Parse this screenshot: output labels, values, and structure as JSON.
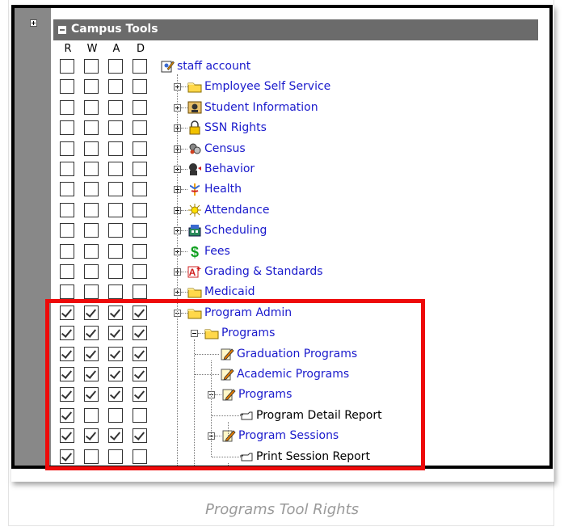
{
  "panel": {
    "title": "Campus Tools",
    "columns": [
      "R",
      "W",
      "A",
      "D"
    ]
  },
  "tree": [
    {
      "label": "staff account",
      "icon": "staff-account-icon",
      "checks": [
        false,
        false,
        false,
        false
      ],
      "indent": 0,
      "toggle": "none",
      "link": true
    },
    {
      "label": "Employee Self Service",
      "icon": "folder-icon",
      "checks": [
        false,
        false,
        false,
        false
      ],
      "indent": 1,
      "toggle": "plus",
      "link": true
    },
    {
      "label": "Student Information",
      "icon": "student-icon",
      "checks": [
        false,
        false,
        false,
        false
      ],
      "indent": 1,
      "toggle": "plus",
      "link": true
    },
    {
      "label": "SSN Rights",
      "icon": "lock-icon",
      "checks": [
        false,
        false,
        false,
        false
      ],
      "indent": 1,
      "toggle": "plus",
      "link": true
    },
    {
      "label": "Census",
      "icon": "census-icon",
      "checks": [
        false,
        false,
        false,
        false
      ],
      "indent": 1,
      "toggle": "plus",
      "link": true
    },
    {
      "label": "Behavior",
      "icon": "behavior-icon",
      "checks": [
        false,
        false,
        false,
        false
      ],
      "indent": 1,
      "toggle": "plus",
      "link": true
    },
    {
      "label": "Health",
      "icon": "health-icon",
      "checks": [
        false,
        false,
        false,
        false
      ],
      "indent": 1,
      "toggle": "plus",
      "link": true
    },
    {
      "label": "Attendance",
      "icon": "attendance-icon",
      "checks": [
        false,
        false,
        false,
        false
      ],
      "indent": 1,
      "toggle": "plus",
      "link": true
    },
    {
      "label": "Scheduling",
      "icon": "scheduling-icon",
      "checks": [
        false,
        false,
        false,
        false
      ],
      "indent": 1,
      "toggle": "plus",
      "link": true
    },
    {
      "label": "Fees",
      "icon": "dollar-icon",
      "checks": [
        false,
        false,
        false,
        false
      ],
      "indent": 1,
      "toggle": "plus",
      "link": true
    },
    {
      "label": "Grading & Standards",
      "icon": "grading-icon",
      "checks": [
        false,
        false,
        false,
        false
      ],
      "indent": 1,
      "toggle": "plus",
      "link": true
    },
    {
      "label": "Medicaid",
      "icon": "folder-icon",
      "checks": [
        false,
        false,
        false,
        false
      ],
      "indent": 1,
      "toggle": "plus",
      "link": true
    },
    {
      "label": "Program Admin",
      "icon": "folder-icon",
      "checks": [
        true,
        true,
        true,
        true
      ],
      "indent": 1,
      "toggle": "minus",
      "link": true
    },
    {
      "label": "Programs",
      "icon": "folder-icon",
      "checks": [
        true,
        true,
        true,
        true
      ],
      "indent": 2,
      "toggle": "minus",
      "link": true
    },
    {
      "label": "Graduation Programs",
      "icon": "edit-icon",
      "checks": [
        true,
        true,
        true,
        true
      ],
      "indent": 3,
      "toggle": "none",
      "link": true
    },
    {
      "label": "Academic Programs",
      "icon": "edit-icon",
      "checks": [
        true,
        true,
        true,
        true
      ],
      "indent": 3,
      "toggle": "none",
      "link": true
    },
    {
      "label": "Programs",
      "icon": "edit-icon",
      "checks": [
        true,
        true,
        true,
        true
      ],
      "indent": 3,
      "toggle": "minus",
      "link": true
    },
    {
      "label": "Program Detail Report",
      "icon": "report-icon",
      "checks": [
        true,
        false,
        false,
        false
      ],
      "indent": 4,
      "toggle": "none",
      "link": false
    },
    {
      "label": "Program Sessions",
      "icon": "edit-icon",
      "checks": [
        true,
        true,
        true,
        true
      ],
      "indent": 3,
      "toggle": "minus",
      "link": true
    },
    {
      "label": "Print Session Report",
      "icon": "report-icon",
      "checks": [
        true,
        false,
        false,
        false
      ],
      "indent": 4,
      "toggle": "none",
      "link": false
    }
  ],
  "caption": "Programs Tool Rights",
  "colors": {
    "header_bg": "#6b6b6b",
    "gutter_bg": "#888888",
    "link": "#1a1acc",
    "highlight": "#ee0a0a"
  }
}
